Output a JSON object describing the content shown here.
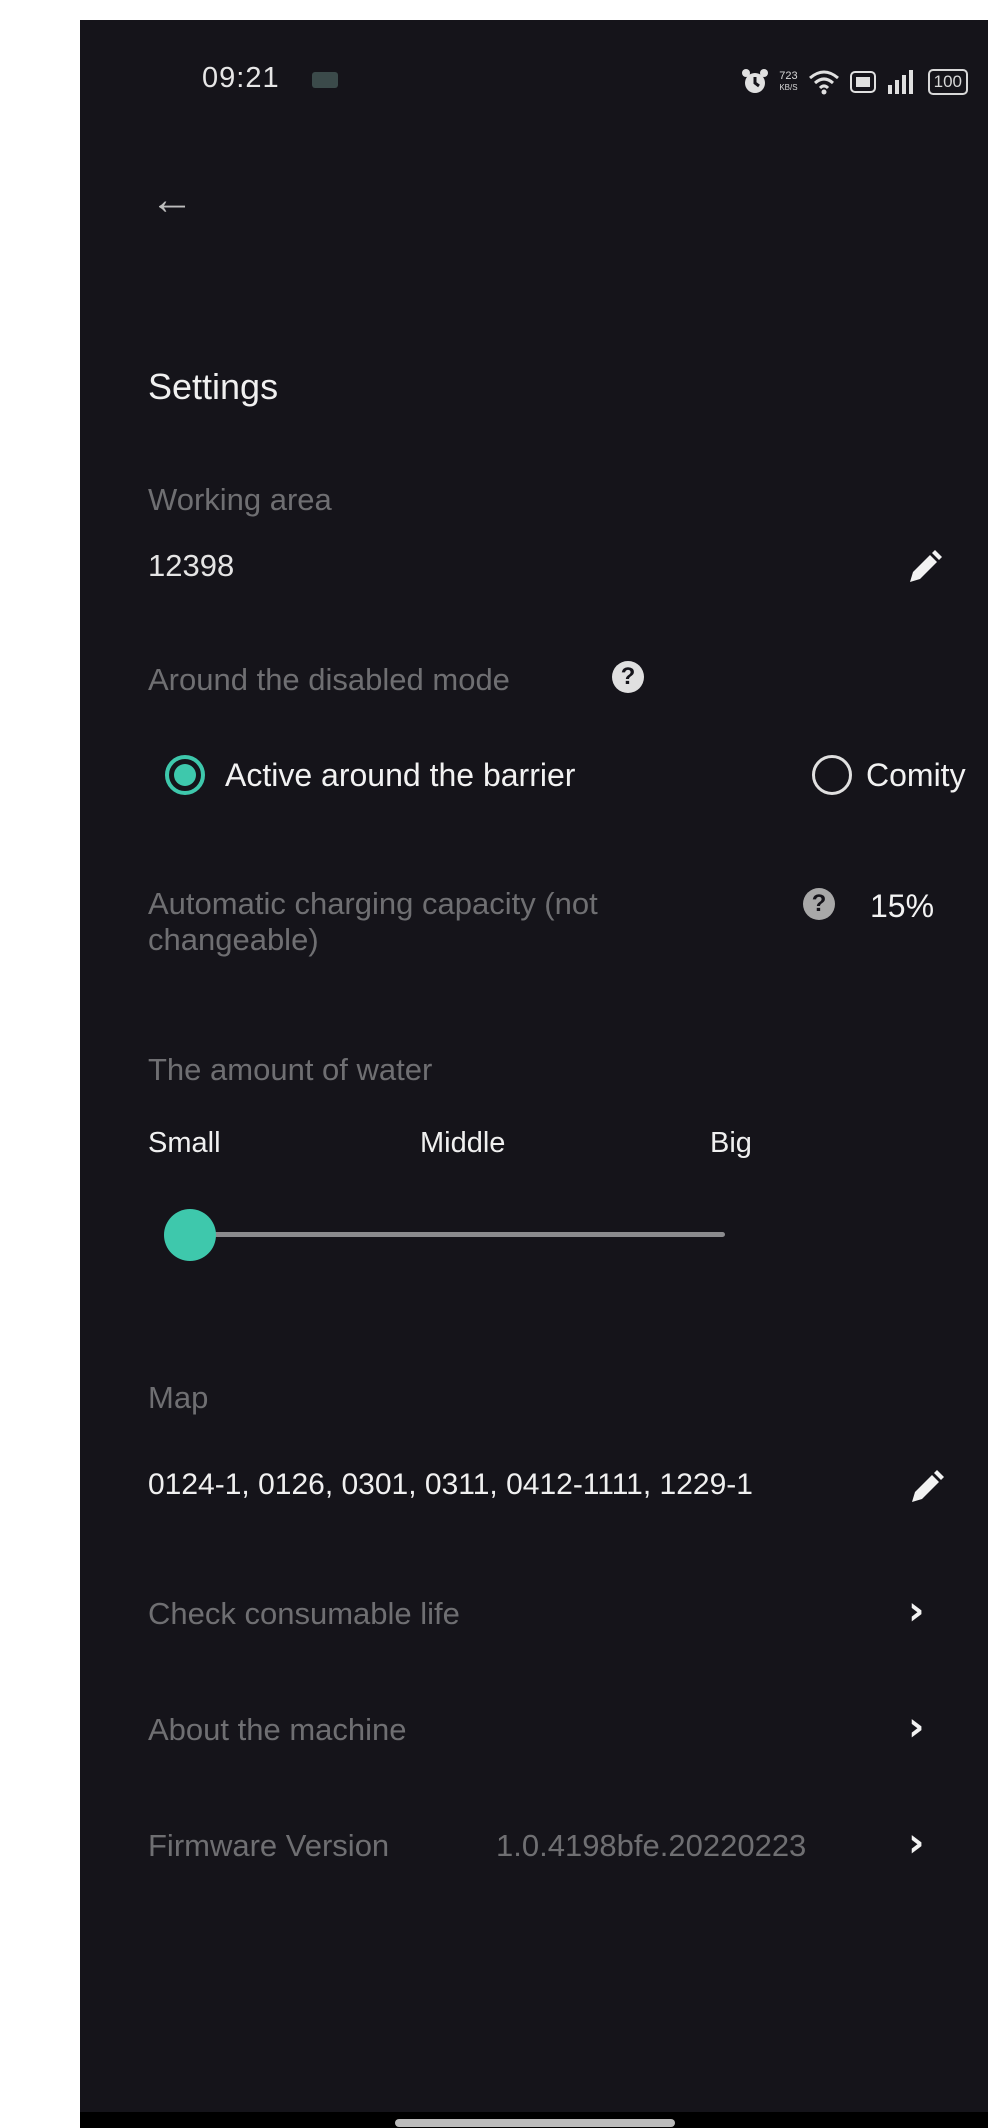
{
  "status_bar": {
    "time": "09:21",
    "network_speed_value": "723",
    "network_speed_unit": "KB/S",
    "battery": "100"
  },
  "page": {
    "title": "Settings"
  },
  "working_area": {
    "label": "Working area",
    "value": "12398"
  },
  "disabled_mode": {
    "label": "Around the disabled mode",
    "options": [
      {
        "label": "Active around the barrier",
        "selected": true
      },
      {
        "label": "Comity",
        "selected": false
      }
    ]
  },
  "charging": {
    "label": "Automatic charging capacity (not changeable)",
    "value": "15%"
  },
  "water": {
    "label": "The amount of water",
    "levels": [
      "Small",
      "Middle",
      "Big"
    ],
    "selected_index": 0
  },
  "map": {
    "label": "Map",
    "value": "0124-1, 0126, 0301, 0311, 0412-1111, 1229-1"
  },
  "menu": {
    "consumable": "Check consumable life",
    "about": "About the machine",
    "firmware_label": "Firmware Version",
    "firmware_value": "1.0.4198bfe.20220223"
  },
  "colors": {
    "accent": "#3ec8ac",
    "background": "#15141a",
    "muted_text": "#6f6f72"
  }
}
